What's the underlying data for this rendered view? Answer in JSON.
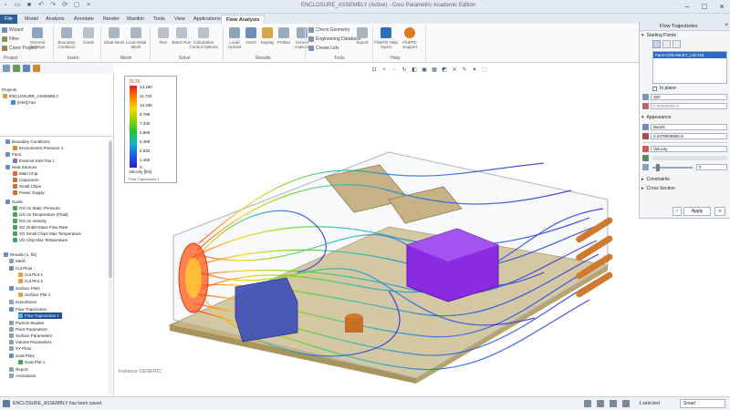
{
  "app": {
    "title": "ENCLOSURE_ASSEMBLY (Active) - Creo Parametric Academic Edition"
  },
  "ribbon": {
    "tabs": [
      {
        "label": "File"
      },
      {
        "label": "Model"
      },
      {
        "label": "Analysis"
      },
      {
        "label": "Annotate"
      },
      {
        "label": "Render"
      },
      {
        "label": "Manikin"
      },
      {
        "label": "Tools"
      },
      {
        "label": "View"
      },
      {
        "label": "Applications"
      },
      {
        "label": "Flow Analysis"
      }
    ],
    "left_items": [
      "Wizard",
      "Filter",
      "Clone Project"
    ],
    "buttons": [
      {
        "label": "General Settings"
      },
      {
        "label": "Boundary Condition"
      },
      {
        "label": "Goals"
      },
      {
        "label": "Initial Mesh"
      },
      {
        "label": "Local Initial Mesh"
      },
      {
        "label": "Run"
      },
      {
        "label": "Batch Run"
      },
      {
        "label": "Calculation Control Options"
      },
      {
        "label": "Load/ Unload"
      },
      {
        "label": "Insert"
      },
      {
        "label": "Display"
      },
      {
        "label": "Probes"
      },
      {
        "label": "Screen Capture"
      }
    ],
    "tools_items": [
      "Check Geometry",
      "Engineering Database",
      "Create Lids"
    ],
    "extra_buttons": [
      {
        "label": "Export"
      },
      {
        "label": "FloEFD Help Topics"
      },
      {
        "label": "FloEFD Support"
      }
    ],
    "groups": [
      "Project",
      "Insert",
      "Mesh",
      "Solve",
      "Results",
      "Tools",
      "Help"
    ]
  },
  "tree": {
    "project_root": "Projects",
    "assembly": "ENCLOSURE_ASSEMBLY",
    "project": "[Inlet] Fan",
    "items": [
      "Boundary Conditions",
      "Environment Pressure 1",
      "Fans",
      "External Inlet Fan 1",
      "Heat Sources",
      "Main Chip",
      "Capacitors",
      "Small Chips",
      "Power Supply",
      "Goals",
      "GG Av Static Pressure",
      "GG Av Temperature (Fluid)",
      "GG Av Velocity",
      "SG Outlet Mass Flow Rate",
      "VG Small Chips Max Temperature",
      "VG Chip Max Temperature",
      "Results (1, fld)",
      "Mesh",
      "Cut Plots",
      "Cut Plot 1",
      "Cut Plot 2",
      "Surface Plots",
      "Surface Plot 1",
      "Isosurfaces",
      "Flow Trajectories",
      "Flow Trajectories 1",
      "Particle Studies",
      "Point Parameters",
      "Surface Parameters",
      "Volume Parameters",
      "XY Plots",
      "Goal Plots",
      "Goal Plot 1",
      "Report",
      "Animations"
    ]
  },
  "legend": {
    "max_label": "20.26",
    "values": [
      "13.180",
      "11.732",
      "10.265",
      "8.798",
      "7.330",
      "5.866",
      "4.399",
      "2.933",
      "1.466",
      "0"
    ],
    "unit": "Velocity [ft/s]",
    "footer": "Flow Trajectories 1"
  },
  "viewport": {
    "instance_label": "Instance GENERIC"
  },
  "panel": {
    "title": "Flow Trajectories",
    "starting_points": "Starting Points",
    "face_ref": "Face<105>INLET_LID-101",
    "in_plane": "In plane",
    "count": "200",
    "offset": "0.00000000 in",
    "appearance": "Appearance",
    "draw_as": "Bands",
    "width": "0.0378936965 in",
    "color_by": "Velocity",
    "opacity_value": "0",
    "constraints": "Constraints",
    "cross_section": "Cross Section",
    "apply_label": "Apply"
  },
  "status": {
    "message": "ENCLOSURE_ASSEMBLY has been saved.",
    "selected": "1 selected",
    "filter": "Smart"
  },
  "colors": {
    "accent": "#2c5f96",
    "tree_selection": "#1f4f9a",
    "heat_source": "#8a2be2",
    "board": "#c9b27a",
    "fan_fins": "#d07a2e"
  }
}
